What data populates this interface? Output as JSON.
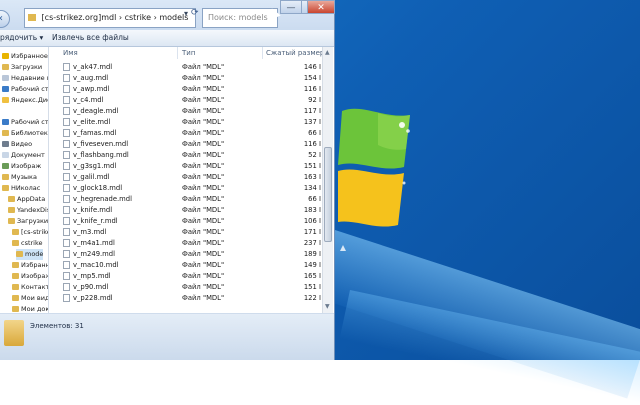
{
  "window": {
    "address": "[cs-strikez.org]mdl  ›  cstrike  ›  models",
    "search_placeholder": "Поиск: models",
    "back_icon": "back-arrow-icon",
    "forward_icon": "forward-arrow-icon",
    "dropdown_icon": "chevron-down-icon",
    "refresh_icon": "refresh-icon",
    "minimize": "—",
    "maximize": "□",
    "close": "✕"
  },
  "toolbar": {
    "organize_label": "рядочить ▾",
    "extract_label": "Извлечь все файлы"
  },
  "sidebar": {
    "items": [
      {
        "label": "Избранное",
        "icon": "star-icon",
        "color": "#e8b400"
      },
      {
        "label": "Загрузки",
        "icon": "folder-icon",
        "color": "#e0b850"
      },
      {
        "label": "Недавние ме",
        "icon": "folder-icon",
        "color": "#b9c6d8"
      },
      {
        "label": "Рабочий стол",
        "icon": "desktop-icon",
        "color": "#3a7bc8"
      },
      {
        "label": "Яндекс.Диск",
        "icon": "disk-icon",
        "color": "#f0c040"
      },
      {
        "label": "",
        "icon": "",
        "color": "#ffffff"
      },
      {
        "label": "Рабочий стол",
        "icon": "desktop-icon",
        "color": "#3a7bc8"
      },
      {
        "label": "Библиотеки",
        "icon": "library-icon",
        "color": "#e0b850"
      },
      {
        "label": "Видео",
        "icon": "video-icon",
        "color": "#6f7d8e"
      },
      {
        "label": "Документ",
        "icon": "document-icon",
        "color": "#c9d6e6"
      },
      {
        "label": "Изображ",
        "icon": "picture-icon",
        "color": "#6b9c58"
      },
      {
        "label": "Музыка",
        "icon": "music-icon",
        "color": "#e0b850"
      },
      {
        "label": "НИколас",
        "icon": "user-icon",
        "color": "#e0b850"
      },
      {
        "label": "AppData",
        "icon": "folder-icon",
        "color": "#e0b850"
      },
      {
        "label": "YandexDisk",
        "icon": "folder-icon",
        "color": "#e0b850"
      },
      {
        "label": "Загрузки",
        "icon": "folder-icon",
        "color": "#e0b850"
      },
      {
        "label": "[cs-strikez",
        "icon": "folder-icon",
        "color": "#e0b850"
      },
      {
        "label": "cstrike",
        "icon": "folder-icon",
        "color": "#e0b850"
      },
      {
        "label": "mode",
        "icon": "folder-icon",
        "color": "#e0b850"
      },
      {
        "label": "Избранное",
        "icon": "folder-icon",
        "color": "#e0b850"
      },
      {
        "label": "Изображен",
        "icon": "folder-icon",
        "color": "#e0b850"
      },
      {
        "label": "Контакты",
        "icon": "folder-icon",
        "color": "#e0b850"
      },
      {
        "label": "Мои видео",
        "icon": "folder-icon",
        "color": "#e0b850"
      },
      {
        "label": "Мои докум",
        "icon": "folder-icon",
        "color": "#e0b850"
      }
    ]
  },
  "columns": {
    "name": "Имя",
    "type": "Тип",
    "size": "Сжатый размер"
  },
  "files": [
    {
      "name": "v_ak47.mdl",
      "type": "Файл \"MDL\"",
      "size": "146 I"
    },
    {
      "name": "v_aug.mdl",
      "type": "Файл \"MDL\"",
      "size": "154 I"
    },
    {
      "name": "v_awp.mdl",
      "type": "Файл \"MDL\"",
      "size": "116 I"
    },
    {
      "name": "v_c4.mdl",
      "type": "Файл \"MDL\"",
      "size": "92 I"
    },
    {
      "name": "v_deagle.mdl",
      "type": "Файл \"MDL\"",
      "size": "117 I"
    },
    {
      "name": "v_elite.mdl",
      "type": "Файл \"MDL\"",
      "size": "137 I"
    },
    {
      "name": "v_famas.mdl",
      "type": "Файл \"MDL\"",
      "size": "66 I"
    },
    {
      "name": "v_fiveseven.mdl",
      "type": "Файл \"MDL\"",
      "size": "116 I"
    },
    {
      "name": "v_flashbang.mdl",
      "type": "Файл \"MDL\"",
      "size": "52 I"
    },
    {
      "name": "v_g3sg1.mdl",
      "type": "Файл \"MDL\"",
      "size": "151 I"
    },
    {
      "name": "v_galil.mdl",
      "type": "Файл \"MDL\"",
      "size": "163 I"
    },
    {
      "name": "v_glock18.mdl",
      "type": "Файл \"MDL\"",
      "size": "134 I"
    },
    {
      "name": "v_hegrenade.mdl",
      "type": "Файл \"MDL\"",
      "size": "66 I"
    },
    {
      "name": "v_knife.mdl",
      "type": "Файл \"MDL\"",
      "size": "183 I"
    },
    {
      "name": "v_knife_r.mdl",
      "type": "Файл \"MDL\"",
      "size": "106 I"
    },
    {
      "name": "v_m3.mdl",
      "type": "Файл \"MDL\"",
      "size": "171 I"
    },
    {
      "name": "v_m4a1.mdl",
      "type": "Файл \"MDL\"",
      "size": "237 I"
    },
    {
      "name": "v_m249.mdl",
      "type": "Файл \"MDL\"",
      "size": "189 I"
    },
    {
      "name": "v_mac10.mdl",
      "type": "Файл \"MDL\"",
      "size": "149 I"
    },
    {
      "name": "v_mp5.mdl",
      "type": "Файл \"MDL\"",
      "size": "165 I"
    },
    {
      "name": "v_p90.mdl",
      "type": "Файл \"MDL\"",
      "size": "151 I"
    },
    {
      "name": "v_p228.mdl",
      "type": "Файл \"MDL\"",
      "size": "122 I"
    }
  ],
  "status": {
    "count": "Элементов: 31"
  }
}
